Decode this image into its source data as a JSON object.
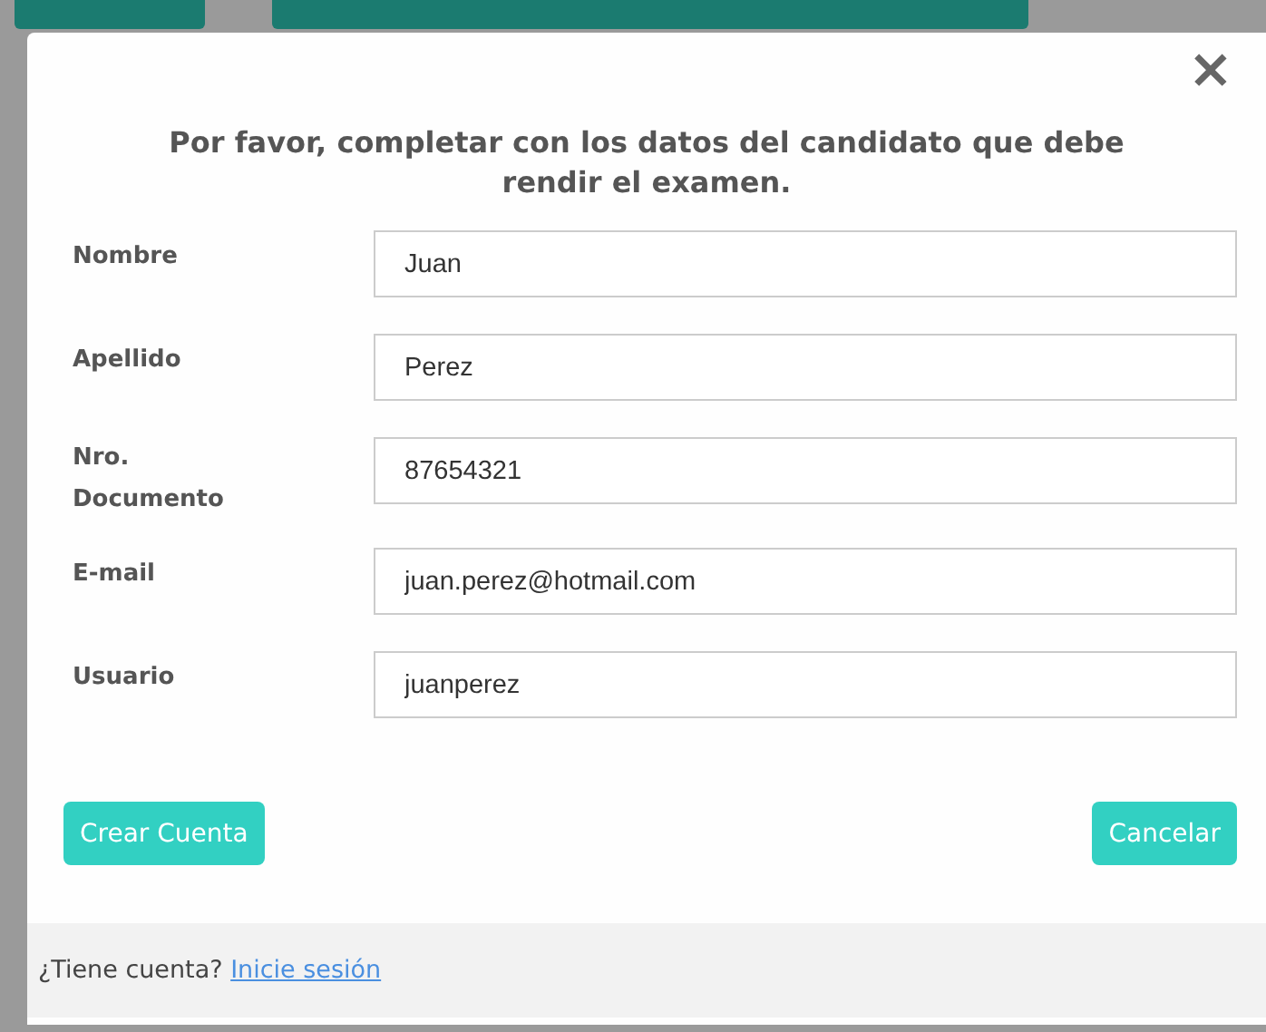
{
  "dialog": {
    "close": "×",
    "title": "Por favor, completar con los datos del candidato que debe rendir el examen.",
    "fields": [
      {
        "label": "Nombre",
        "value": "Juan"
      },
      {
        "label": "Apellido",
        "value": "Perez"
      },
      {
        "label": "Nro. Documento",
        "value": "87654321"
      },
      {
        "label": "E-mail",
        "value": "juan.perez@hotmail.com"
      },
      {
        "label": "Usuario",
        "value": "juanperez"
      }
    ],
    "buttons": [
      {
        "label": "Crear Cuenta"
      },
      {
        "label": "Cancelar"
      }
    ],
    "footer": {
      "text": "¿Tiene cuenta?",
      "link": "Inicie sesión"
    }
  }
}
